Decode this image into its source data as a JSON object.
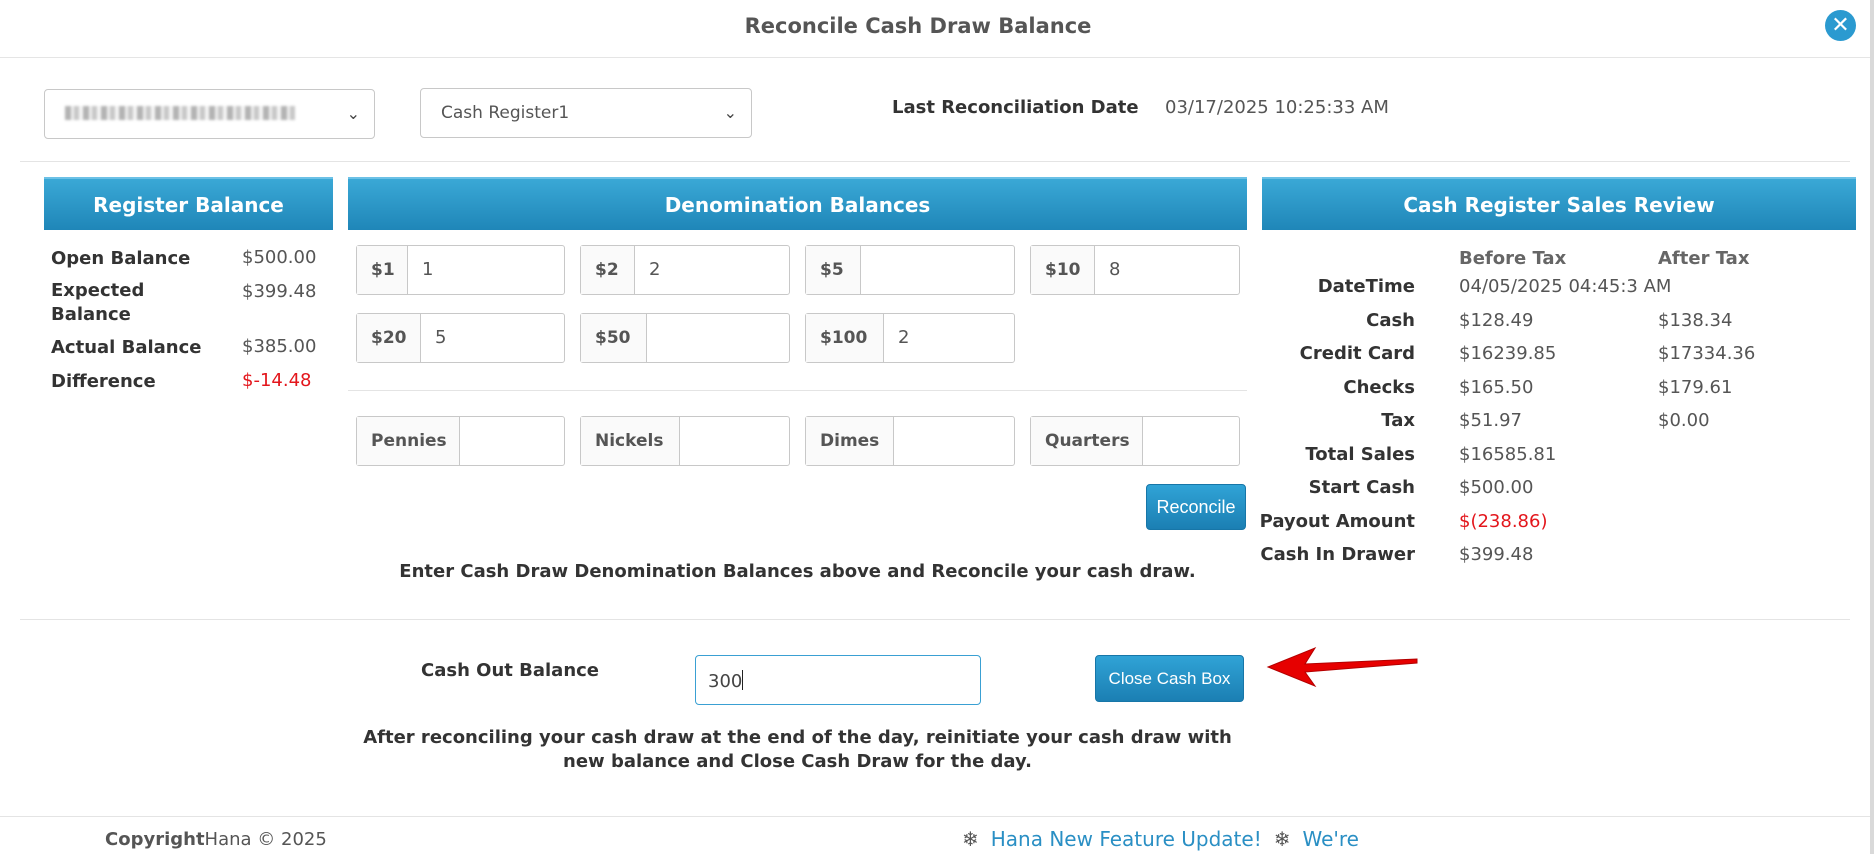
{
  "window": {
    "title": "Reconcile Cash Draw Balance",
    "close_icon": "close-circle-icon"
  },
  "filters": {
    "store_select_value": "(redacted store name)",
    "register_select_value": "Cash Register1",
    "chevron_icon": "chevron-down-icon"
  },
  "last_reconciliation": {
    "label": "Last Reconciliation Date",
    "value": "03/17/2025 10:25:33 AM"
  },
  "register_balance": {
    "header": "Register Balance",
    "rows": [
      {
        "label": "Open Balance",
        "value": "$500.00"
      },
      {
        "label": "Expected Balance",
        "value": "$399.48"
      },
      {
        "label": "Actual Balance",
        "value": "$385.00"
      },
      {
        "label": "Difference",
        "value": "$-14.48"
      }
    ]
  },
  "denominations": {
    "header": "Denomination Balances",
    "bills": [
      {
        "label": "$1",
        "value": "1"
      },
      {
        "label": "$2",
        "value": "2"
      },
      {
        "label": "$5",
        "value": ""
      },
      {
        "label": "$10",
        "value": "8"
      },
      {
        "label": "$20",
        "value": "5"
      },
      {
        "label": "$50",
        "value": ""
      },
      {
        "label": "$100",
        "value": "2"
      }
    ],
    "coins": [
      {
        "label": "Pennies",
        "value": ""
      },
      {
        "label": "Nickels",
        "value": ""
      },
      {
        "label": "Dimes",
        "value": ""
      },
      {
        "label": "Quarters",
        "value": ""
      }
    ],
    "reconcile_button": "Reconcile",
    "hint": "Enter Cash Draw Denomination Balances above and Reconcile your cash draw."
  },
  "sales_review": {
    "header": "Cash Register Sales Review",
    "col_before": "Before Tax",
    "col_after": "After Tax",
    "datetime_label": "DateTime",
    "datetime_value": "04/05/2025 04:45:3 AM",
    "rows": [
      {
        "label": "Cash",
        "before": "$128.49",
        "after": "$138.34"
      },
      {
        "label": "Credit Card",
        "before": "$16239.85",
        "after": "$17334.36"
      },
      {
        "label": "Checks",
        "before": "$165.50",
        "after": "$179.61"
      },
      {
        "label": "Tax",
        "before": "$51.97",
        "after": "$0.00"
      },
      {
        "label": "Total Sales",
        "before": "$16585.81",
        "after": ""
      },
      {
        "label": "Start Cash",
        "before": "$500.00",
        "after": ""
      },
      {
        "label": "Payout Amount",
        "before": "$(238.86)",
        "after": ""
      },
      {
        "label": "Cash In Drawer",
        "before": "$399.48",
        "after": ""
      }
    ]
  },
  "cash_out": {
    "label": "Cash Out Balance",
    "value": "300",
    "button": "Close Cash Box",
    "hint": "After reconciling your cash draw at the end of the day, reinitiate your cash draw with new balance and Close Cash Draw for the day.",
    "arrow_icon": "red-arrow-pointer-icon"
  },
  "footer": {
    "copyright_bold": "Copyright",
    "copyright_rest": "Hana © 2025",
    "snowflake_icon": "snowflake-icon",
    "ticker_text_1": "Hana New Feature Update!",
    "ticker_text_2": "We're"
  },
  "colors": {
    "accent": "#2b9ad0",
    "negative": "#e3161c",
    "annotation_arrow": "#e60000"
  }
}
